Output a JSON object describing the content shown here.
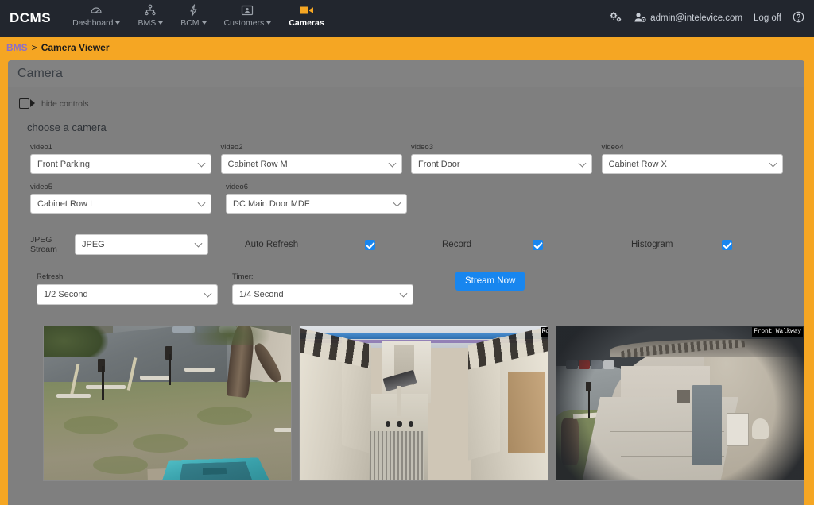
{
  "nav": {
    "brand": "DCMS",
    "items": [
      {
        "label": "Dashboard",
        "icon": "speedometer-icon",
        "caret": true,
        "active": false
      },
      {
        "label": "BMS",
        "icon": "sitemap-icon",
        "caret": true,
        "active": false
      },
      {
        "label": "BCM",
        "icon": "bolt-icon",
        "caret": true,
        "active": false
      },
      {
        "label": "Customers",
        "icon": "user-card-icon",
        "caret": true,
        "active": false
      },
      {
        "label": "Cameras",
        "icon": "video-camera-icon",
        "caret": false,
        "active": true
      }
    ],
    "right": {
      "settings_icon": "gears-icon",
      "user_icon": "user-settings-icon",
      "user": "admin@intelevice.com",
      "logoff": "Log off",
      "help_icon": "help-circle-icon"
    }
  },
  "breadcrumb": {
    "link": "BMS",
    "separator": ">",
    "current": "Camera Viewer"
  },
  "panel": {
    "title": "Camera",
    "hide_controls_label": "hide controls",
    "hide_controls_icon": "video-camera-icon",
    "section_title": "choose a camera"
  },
  "cameras": [
    {
      "label": "video1",
      "value": "Front Parking"
    },
    {
      "label": "video2",
      "value": "Cabinet Row M"
    },
    {
      "label": "video3",
      "value": "Front Door"
    },
    {
      "label": "video4",
      "value": "Cabinet Row X"
    },
    {
      "label": "video5",
      "value": "Cabinet Row I"
    },
    {
      "label": "video6",
      "value": "DC Main Door MDF"
    }
  ],
  "options": {
    "jpeg_stream_label_line1": "JPEG",
    "jpeg_stream_label_line2": "Stream",
    "jpeg_stream_value": "JPEG",
    "auto_refresh_label": "Auto Refresh",
    "auto_refresh_checked": true,
    "record_label": "Record",
    "record_checked": true,
    "histogram_label": "Histogram",
    "histogram_checked": true
  },
  "timing": {
    "refresh_label": "Refresh:",
    "refresh_value": "1/2 Second",
    "timer_label": "Timer:",
    "timer_value": "1/4 Second",
    "stream_button": "Stream Now"
  },
  "thumbnails": [
    {
      "overlay": "",
      "scene": "front-parking"
    },
    {
      "overlay": "Row M",
      "scene": "cabinet-row"
    },
    {
      "overlay": "Front Walkway",
      "scene": "front-walkway"
    }
  ],
  "colors": {
    "page_background": "#f5a623",
    "nav_background": "#22262e",
    "panel_background": "#7f7f7f",
    "panel_header": "#828282",
    "accent_blue": "#1886ef",
    "breadcrumb_link": "#8c6fc8",
    "cameras_active_icon": "#f5a623"
  }
}
